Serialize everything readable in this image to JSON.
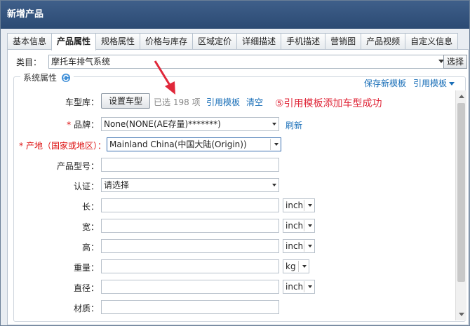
{
  "window": {
    "title": "新增产品"
  },
  "tabs": [
    {
      "label": "基本信息"
    },
    {
      "label": "产品属性",
      "active": true
    },
    {
      "label": "规格属性"
    },
    {
      "label": "价格与库存"
    },
    {
      "label": "区域定价"
    },
    {
      "label": "详细描述"
    },
    {
      "label": "手机描述"
    },
    {
      "label": "营销图"
    },
    {
      "label": "产品视频"
    },
    {
      "label": "自定义信息"
    }
  ],
  "category": {
    "label": "类目：",
    "value": "摩托车排气系统",
    "select_button": "选择"
  },
  "attributes": {
    "legend": "系统属性",
    "save_template": "保存新模板",
    "use_template": "引用模板"
  },
  "vehicle": {
    "label": "车型库：",
    "button": "设置车型",
    "selected_text": "已选 198 项",
    "use_template": "引用模板",
    "clear": "清空"
  },
  "annotation": {
    "text": "⑤引用模板添加车型成功",
    "color": "#e0283a"
  },
  "fields": {
    "brand": {
      "label": "品牌：",
      "value": "None(NONE(AE存量)*******)",
      "refresh": "刷新"
    },
    "origin": {
      "label": "产地（国家或地区）：",
      "value": "Mainland China(中国大陆(Origin))"
    },
    "model": {
      "label": "产品型号：",
      "value": ""
    },
    "cert": {
      "label": "认证：",
      "value": "请选择"
    },
    "length": {
      "label": "长：",
      "value": "",
      "unit": "inch"
    },
    "width": {
      "label": "宽：",
      "value": "",
      "unit": "inch"
    },
    "height": {
      "label": "高：",
      "value": "",
      "unit": "inch"
    },
    "weight": {
      "label": "重量：",
      "value": "",
      "unit": "kg"
    },
    "diameter": {
      "label": "直径：",
      "value": "",
      "unit": "inch"
    },
    "material": {
      "label": "材质：",
      "value": ""
    }
  },
  "colors": {
    "accent": "#1a6fb8",
    "title_bar": "#2b4a73",
    "required": "#d11111"
  }
}
